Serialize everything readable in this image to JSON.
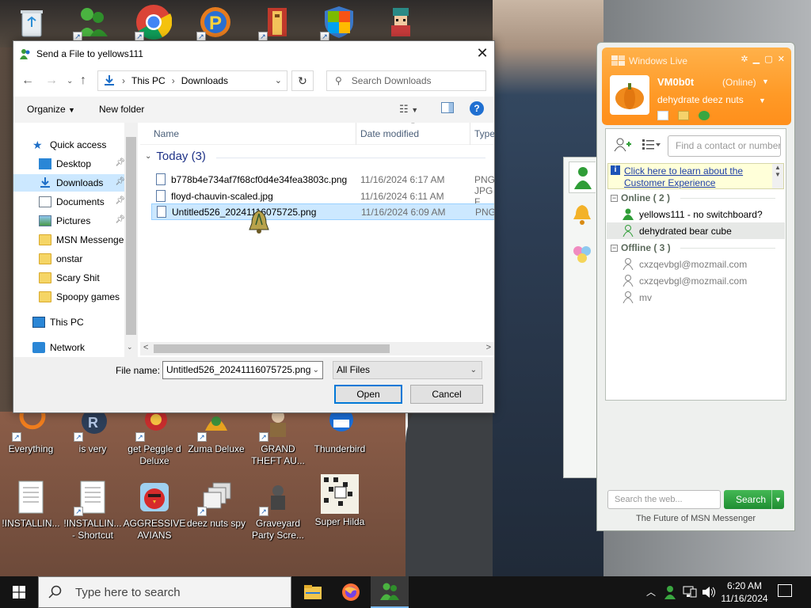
{
  "desktop": {
    "top_icons": [
      {
        "name": "recycle-bin-icon"
      },
      {
        "name": "msn-messenger-icon"
      },
      {
        "name": "chrome-icon"
      },
      {
        "name": "peggle-p-icon"
      },
      {
        "name": "winrar-icon"
      },
      {
        "name": "windows-shield-icon"
      },
      {
        "name": "pixel-character-icon"
      }
    ],
    "row1": [
      {
        "label": "Everything"
      },
      {
        "label": "is very"
      },
      {
        "label": "get Peggle d Deluxe"
      },
      {
        "label": "Zuma Deluxe"
      },
      {
        "label": "GRAND THEFT AU..."
      },
      {
        "label": "Thunderbird"
      }
    ],
    "row2": [
      {
        "label": "!INSTALLIN..."
      },
      {
        "label": "!INSTALLIN... - Shortcut"
      },
      {
        "label": "AGGRESSIVE AVIANS"
      },
      {
        "label": "deez nuts spy"
      },
      {
        "label": "Graveyard Party Scre..."
      },
      {
        "label": "Super Hilda"
      }
    ],
    "partial_left_label": "d"
  },
  "dialog": {
    "title": "Send a File to yellows111",
    "address": {
      "root": "This PC",
      "folder": "Downloads"
    },
    "search_placeholder": "Search Downloads",
    "toolbar": {
      "organize": "Organize",
      "new_folder": "New folder",
      "help": "?"
    },
    "nav": [
      {
        "label": "Quick access",
        "icon": "star-icon"
      },
      {
        "label": "Desktop",
        "icon": "desktop-icon",
        "pinned": true
      },
      {
        "label": "Downloads",
        "icon": "download-icon",
        "pinned": true,
        "selected": true
      },
      {
        "label": "Documents",
        "icon": "documents-icon",
        "pinned": true
      },
      {
        "label": "Pictures",
        "icon": "pictures-icon",
        "pinned": true
      },
      {
        "label": "MSN Messenger",
        "icon": "folder-icon"
      },
      {
        "label": "onstar",
        "icon": "folder-icon"
      },
      {
        "label": "Scary Shit",
        "icon": "folder-icon"
      },
      {
        "label": "Spoopy games",
        "icon": "folder-icon"
      },
      {
        "label": "This PC",
        "icon": "computer-icon"
      },
      {
        "label": "Network",
        "icon": "network-icon"
      }
    ],
    "columns": {
      "name": "Name",
      "date": "Date modified",
      "type": "Type"
    },
    "group": "Today (3)",
    "files": [
      {
        "name": "b778b4e734af7f68cf0d4e34fea3803c.png",
        "date": "11/16/2024 6:17 AM",
        "type": "PNG"
      },
      {
        "name": "floyd-chauvin-scaled.jpg",
        "date": "11/16/2024 6:11 AM",
        "type": "JPG F"
      },
      {
        "name": "Untitled526_20241116075725.png",
        "date": "11/16/2024 6:09 AM",
        "type": "PNG",
        "selected": true
      }
    ],
    "file_name_label": "File name:",
    "file_name_value": "Untitled526_20241116075725.png",
    "filter": "All Files",
    "open": "Open",
    "cancel": "Cancel"
  },
  "msn": {
    "title": "Windows Live",
    "username": "VM0b0t",
    "status": "(Online)",
    "psm": "dehydrate deez nuts",
    "find_placeholder": "Find a contact or number",
    "info": "Click here to learn about the Customer Experience",
    "online_header": "Online ( 2 )",
    "online": [
      {
        "name": "yellows111 - no switchboard?"
      },
      {
        "name": "dehydrated bear cube",
        "selected": true
      }
    ],
    "offline_header": "Offline ( 3 )",
    "offline": [
      {
        "name": "cxzqevbgl@mozmail.com"
      },
      {
        "name": "cxzqevbgl@mozmail.com"
      },
      {
        "name": "mv"
      }
    ],
    "search_placeholder": "Search the web...",
    "search_button": "Search",
    "footer": "The Future of MSN Messenger"
  },
  "taskbar": {
    "search_placeholder": "Type here to search",
    "apps": [
      "file-explorer-icon",
      "firefox-icon",
      "msn-messenger-icon"
    ],
    "time": "6:20 AM",
    "date": "11/16/2024"
  },
  "colors": {
    "msn_orange": "#ff9a27",
    "selection_blue": "#cce8ff",
    "open_button_border": "#0078d7",
    "msn_green": "#1f8e32"
  }
}
